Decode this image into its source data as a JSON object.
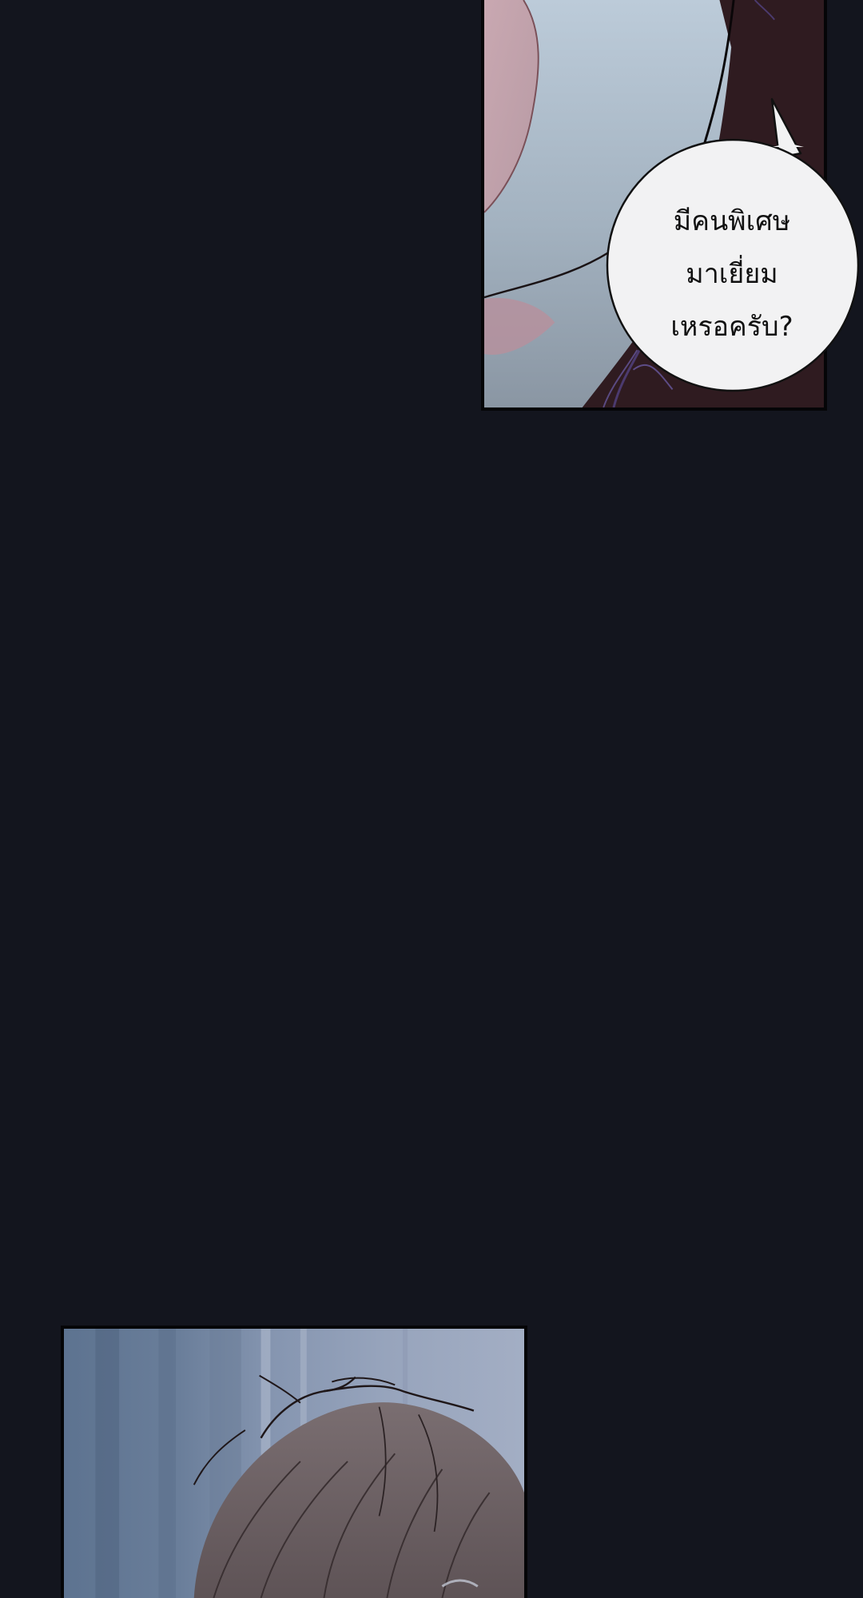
{
  "dialogue": {
    "lines": [
      "มีคนพิเศษ",
      "มาเยี่ยม",
      "เหรอครับ?"
    ]
  },
  "colors": {
    "background": "#13151e",
    "panel_border": "#050507",
    "bubble_fill": "#f2f2f3",
    "bubble_stroke": "#111111",
    "hair": "#6b5f61"
  }
}
